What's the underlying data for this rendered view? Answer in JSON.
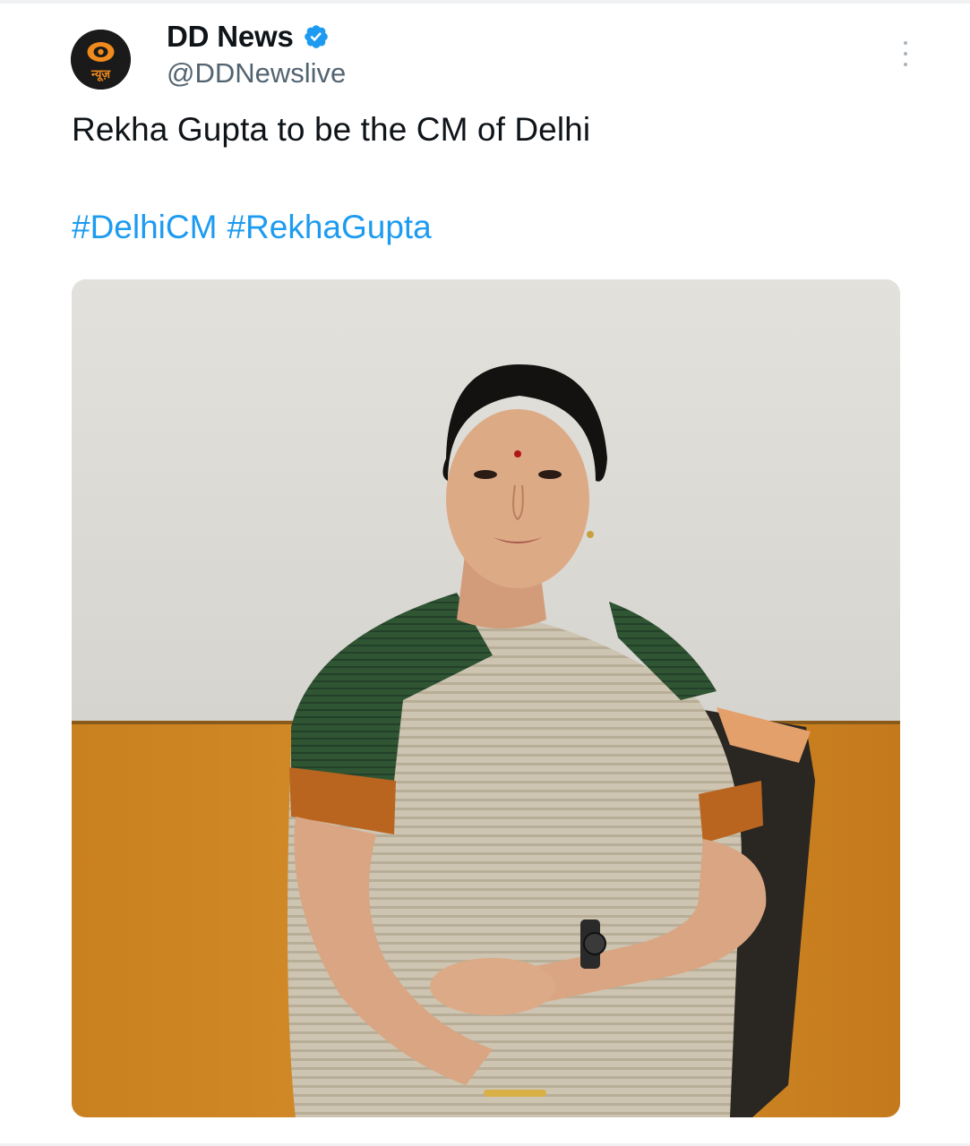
{
  "tweet": {
    "author": {
      "display_name": "DD News",
      "handle": "@DDNewslive",
      "verified": true,
      "avatar_icon": "dd-news-logo-icon",
      "avatar_caption": "न्यूज़"
    },
    "text": "Rekha Gupta to be the CM of Delhi",
    "hashtags": [
      "#DelhiCM",
      "#RekhaGupta"
    ],
    "media": {
      "type": "photo"
    },
    "icons": {
      "verified": "verified-badge-icon",
      "more": "more-options-icon"
    }
  },
  "colors": {
    "text_primary": "#0f1419",
    "text_secondary": "#536471",
    "link": "#1d9bf0",
    "verified": "#1d9bf0"
  }
}
